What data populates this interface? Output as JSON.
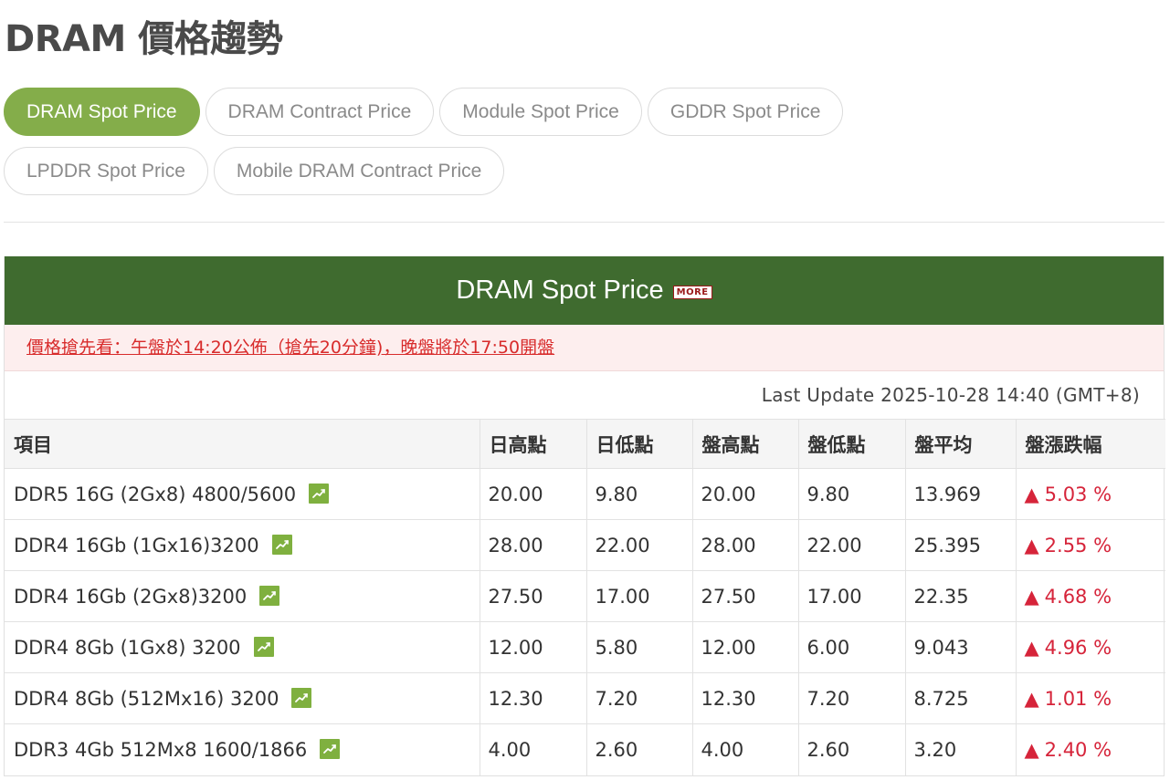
{
  "page": {
    "title": "DRAM 價格趨勢"
  },
  "tabs": [
    {
      "label": "DRAM Spot Price",
      "active": true
    },
    {
      "label": "DRAM Contract Price",
      "active": false
    },
    {
      "label": "Module Spot Price",
      "active": false
    },
    {
      "label": "GDDR Spot Price",
      "active": false
    },
    {
      "label": "LPDDR Spot Price",
      "active": false
    },
    {
      "label": "Mobile DRAM Contract Price",
      "active": false
    }
  ],
  "panel": {
    "title": "DRAM Spot Price",
    "more_badge": "MORE",
    "notice": "價格搶先看：午盤於14:20公佈（搶先20分鐘)，晚盤將於17:50開盤",
    "last_update": "Last Update 2025-10-28 14:40 (GMT+8)"
  },
  "table": {
    "headers": [
      "項目",
      "日高點",
      "日低點",
      "盤高點",
      "盤低點",
      "盤平均",
      "盤漲跌幅"
    ],
    "rows": [
      {
        "item": "DDR5 16G (2Gx8) 4800/5600",
        "day_high": "20.00",
        "day_low": "9.80",
        "session_high": "20.00",
        "session_low": "9.80",
        "session_avg": "13.969",
        "change_arrow": "▲",
        "change": "5.03 %"
      },
      {
        "item": "DDR4 16Gb (1Gx16)3200",
        "day_high": "28.00",
        "day_low": "22.00",
        "session_high": "28.00",
        "session_low": "22.00",
        "session_avg": "25.395",
        "change_arrow": "▲",
        "change": "2.55 %"
      },
      {
        "item": "DDR4 16Gb (2Gx8)3200",
        "day_high": "27.50",
        "day_low": "17.00",
        "session_high": "27.50",
        "session_low": "17.00",
        "session_avg": "22.35",
        "change_arrow": "▲",
        "change": "4.68 %"
      },
      {
        "item": "DDR4 8Gb (1Gx8) 3200",
        "day_high": "12.00",
        "day_low": "5.80",
        "session_high": "12.00",
        "session_low": "6.00",
        "session_avg": "9.043",
        "change_arrow": "▲",
        "change": "4.96 %"
      },
      {
        "item": "DDR4 8Gb (512Mx16) 3200",
        "day_high": "12.30",
        "day_low": "7.20",
        "session_high": "12.30",
        "session_low": "7.20",
        "session_avg": "8.725",
        "change_arrow": "▲",
        "change": "1.01 %"
      },
      {
        "item": "DDR3 4Gb 512Mx8 1600/1866",
        "day_high": "4.00",
        "day_low": "2.60",
        "session_high": "4.00",
        "session_low": "2.60",
        "session_avg": "3.20",
        "change_arrow": "▲",
        "change": "2.40 %"
      }
    ],
    "row_icon": "trend-chart-icon"
  },
  "colors": {
    "accent_green": "#84ad4a",
    "header_green": "#3f6b2f",
    "up_red": "#d6243a",
    "notice_bg": "#fdeeee"
  }
}
